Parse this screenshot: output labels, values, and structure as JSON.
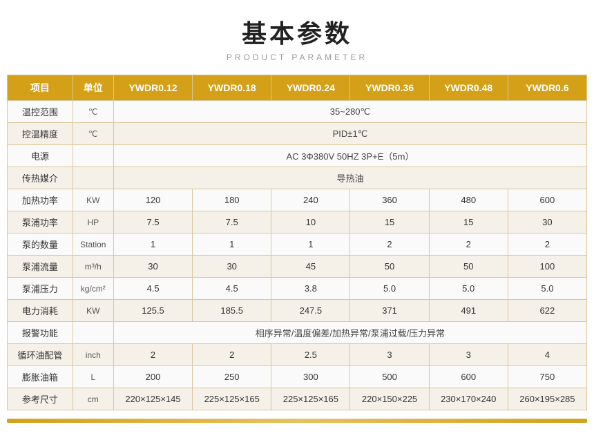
{
  "header": {
    "title": "基本参数",
    "subtitle": "PRODUCT PARAMETER"
  },
  "table": {
    "columns": [
      "项目",
      "单位",
      "YWDR0.12",
      "YWDR0.18",
      "YWDR0.24",
      "YWDR0.36",
      "YWDR0.48",
      "YWDR0.6"
    ],
    "rows": [
      {
        "label": "温控范围",
        "unit": "℃",
        "span": true,
        "spanText": "35~280℃",
        "values": []
      },
      {
        "label": "控温精度",
        "unit": "℃",
        "span": true,
        "spanText": "PID±1℃",
        "values": []
      },
      {
        "label": "电源",
        "unit": "",
        "span": true,
        "spanText": "AC 3Φ380V 50HZ 3P+E（5m）",
        "values": []
      },
      {
        "label": "传热媒介",
        "unit": "",
        "span": true,
        "spanText": "导热油",
        "values": []
      },
      {
        "label": "加热功率",
        "unit": "KW",
        "span": false,
        "values": [
          "120",
          "180",
          "240",
          "360",
          "480",
          "600"
        ]
      },
      {
        "label": "泵浦功率",
        "unit": "HP",
        "span": false,
        "values": [
          "7.5",
          "7.5",
          "10",
          "15",
          "15",
          "30"
        ]
      },
      {
        "label": "泵的数量",
        "unit": "Station",
        "span": false,
        "values": [
          "1",
          "1",
          "1",
          "2",
          "2",
          "2"
        ]
      },
      {
        "label": "泵浦流量",
        "unit": "m³/h",
        "span": false,
        "values": [
          "30",
          "30",
          "45",
          "50",
          "50",
          "100"
        ]
      },
      {
        "label": "泵浦压力",
        "unit": "kg/cm²",
        "span": false,
        "values": [
          "4.5",
          "4.5",
          "3.8",
          "5.0",
          "5.0",
          "5.0"
        ]
      },
      {
        "label": "电力消耗",
        "unit": "KW",
        "span": false,
        "values": [
          "125.5",
          "185.5",
          "247.5",
          "371",
          "491",
          "622"
        ]
      },
      {
        "label": "报警功能",
        "unit": "",
        "span": true,
        "spanText": "相序异常/温度偏差/加热异常/泵浦过载/压力异常",
        "values": []
      },
      {
        "label": "循环油配管",
        "unit": "inch",
        "span": false,
        "values": [
          "2",
          "2",
          "2.5",
          "3",
          "3",
          "4"
        ]
      },
      {
        "label": "膨胀油箱",
        "unit": "L",
        "span": false,
        "values": [
          "200",
          "250",
          "300",
          "500",
          "600",
          "750"
        ]
      },
      {
        "label": "参考尺寸",
        "unit": "cm",
        "span": false,
        "values": [
          "220×125×145",
          "225×125×165",
          "225×125×165",
          "220×150×225",
          "230×170×240",
          "260×195×285"
        ]
      }
    ]
  }
}
